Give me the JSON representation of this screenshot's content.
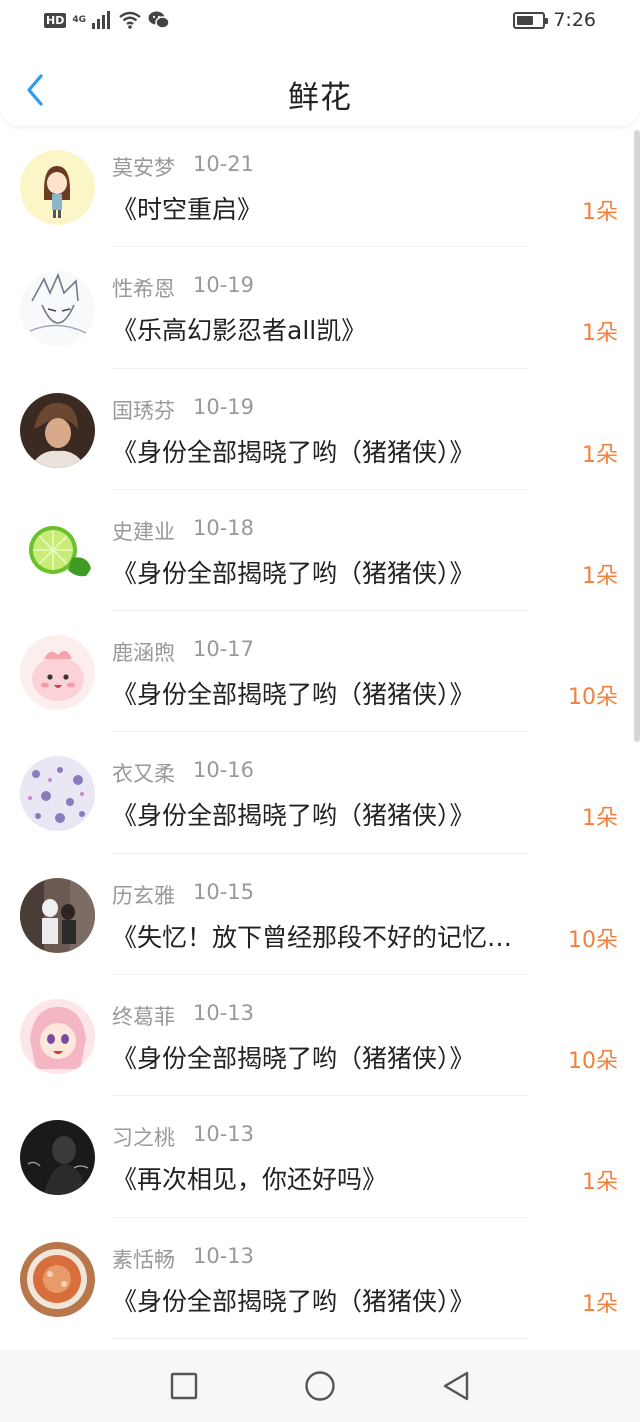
{
  "status_bar": {
    "network_hd": "HD",
    "network_gen": "4G",
    "time": "7:26",
    "battery_level": 0.65
  },
  "nav": {
    "title": "鲜花",
    "back_icon": "chevron-left-icon"
  },
  "colors": {
    "accent": "#2a9bf0",
    "count": "#f0813f",
    "meta": "#999999"
  },
  "items": [
    {
      "name": "莫安梦",
      "date": "10-21",
      "title": "《时空重启》",
      "count": "1朵"
    },
    {
      "name": "性希恩",
      "date": "10-19",
      "title": "《乐高幻影忍者all凯》",
      "count": "1朵"
    },
    {
      "name": "国琇芬",
      "date": "10-19",
      "title": "《身份全部揭晓了哟（猪猪侠）》",
      "count": "1朵"
    },
    {
      "name": "史建业",
      "date": "10-18",
      "title": "《身份全部揭晓了哟（猪猪侠）》",
      "count": "1朵"
    },
    {
      "name": "鹿涵煦",
      "date": "10-17",
      "title": "《身份全部揭晓了哟（猪猪侠）》",
      "count": "10朵"
    },
    {
      "name": "衣又柔",
      "date": "10-16",
      "title": "《身份全部揭晓了哟（猪猪侠）》",
      "count": "1朵"
    },
    {
      "name": "历玄雅",
      "date": "10-15",
      "title": "《失忆！放下曾经那段不好的记忆…",
      "count": "10朵"
    },
    {
      "name": "终葛菲",
      "date": "10-13",
      "title": "《身份全部揭晓了哟（猪猪侠）》",
      "count": "10朵"
    },
    {
      "name": "习之桃",
      "date": "10-13",
      "title": "《再次相见，你还好吗》",
      "count": "1朵"
    },
    {
      "name": "素恬畅",
      "date": "10-13",
      "title": "《身份全部揭晓了哟（猪猪侠）》",
      "count": "1朵"
    }
  ],
  "system_nav": {
    "recent": "square-icon",
    "home": "circle-icon",
    "back": "triangle-back-icon"
  }
}
